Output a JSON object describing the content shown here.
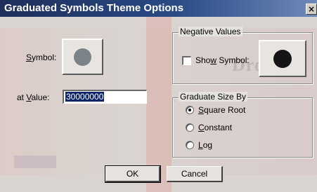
{
  "window": {
    "title": "Graduated Symbols Theme Options",
    "close_glyph": "×"
  },
  "symbol": {
    "label_prefix": "",
    "label_access": "S",
    "label_rest": "ymbol:",
    "swatch_color": "#7a8488"
  },
  "value": {
    "label_prefix": "at ",
    "label_access": "V",
    "label_rest": "alue:",
    "input_value": "30000000"
  },
  "negative_values": {
    "group_title": "Negative Values",
    "show_symbol_prefix": "Sho",
    "show_symbol_access": "w",
    "show_symbol_rest": " Symbol:",
    "show_symbol_checked": false,
    "swatch_color": "#151515"
  },
  "graduate": {
    "group_title": "Graduate Size By",
    "options": [
      {
        "access": "S",
        "rest": "quare Root",
        "selected": true
      },
      {
        "access": "C",
        "rest": "onstant",
        "selected": false
      },
      {
        "access": "L",
        "rest": "og",
        "selected": false
      }
    ]
  },
  "buttons": {
    "ok_label": "OK",
    "cancel_label": "Cancel"
  },
  "watermark": {
    "text": "DropBo"
  }
}
